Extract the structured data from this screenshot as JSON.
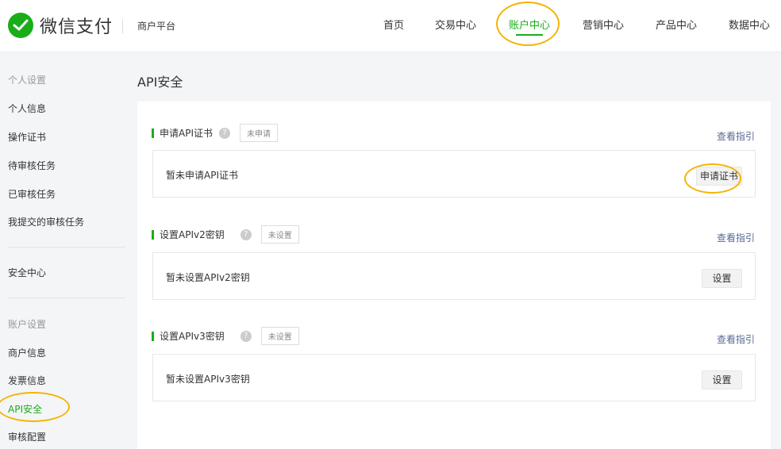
{
  "header": {
    "brand": "微信支付",
    "platform": "商户平台",
    "nav": [
      {
        "label": "首页"
      },
      {
        "label": "交易中心"
      },
      {
        "label": "账户中心"
      },
      {
        "label": "营销中心"
      },
      {
        "label": "产品中心"
      },
      {
        "label": "数据中心"
      }
    ]
  },
  "sidebar": {
    "groups": [
      {
        "title": "个人设置",
        "items": [
          "个人信息",
          "操作证书",
          "待审核任务",
          "已审核任务",
          "我提交的审核任务"
        ]
      },
      {
        "title": "",
        "items": [
          "安全中心"
        ]
      },
      {
        "title": "账户设置",
        "items": [
          "商户信息",
          "发票信息",
          "API安全",
          "审核配置"
        ]
      }
    ]
  },
  "main": {
    "title": "API安全",
    "sections": [
      {
        "title": "申请API证书",
        "badge": "未申请",
        "guide": "查看指引",
        "message": "暂未申请API证书",
        "action": "申请证书"
      },
      {
        "title": "设置APIv2密钥",
        "badge": "未设置",
        "guide": "查看指引",
        "message": "暂未设置APIv2密钥",
        "action": "设置"
      },
      {
        "title": "设置APIv3密钥",
        "badge": "未设置",
        "guide": "查看指引",
        "message": "暂未设置APIv3密钥",
        "action": "设置"
      }
    ]
  },
  "colors": {
    "brand_green": "#1aad19",
    "link_blue": "#576b95",
    "highlight": "#f5b400"
  },
  "icons": {
    "logo": "wechat-pay-check-icon",
    "help": "question-mark-icon"
  }
}
